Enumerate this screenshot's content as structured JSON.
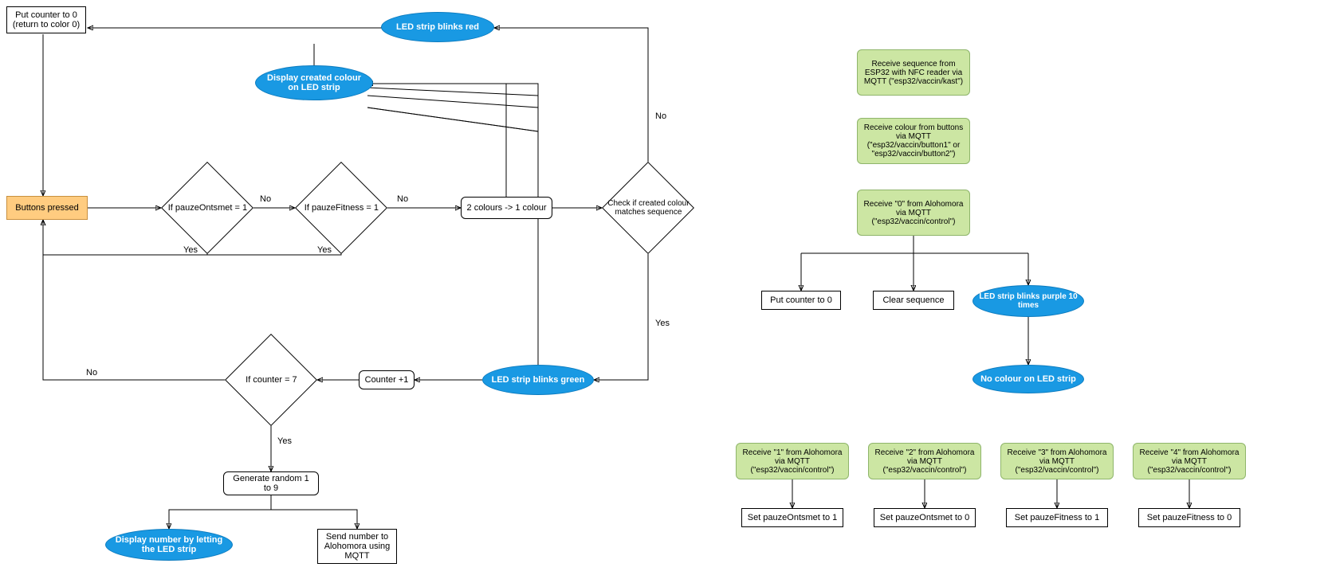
{
  "left": {
    "put_counter_0": "Put counter to 0\n(return to color 0)",
    "buttons_pressed": "Buttons pressed",
    "if_pauze_ontsmet": "If pauzeOntsmet = 1",
    "if_pauze_fitness": "If pauzeFitness = 1",
    "two_colours": "2 colours -> 1 colour",
    "check_match": "Check if created colour matches sequence",
    "led_red": "LED strip blinks red",
    "display_colour": "Display created colour on LED strip",
    "led_green": "LED strip blinks green",
    "counter_plus": "Counter +1",
    "if_counter_7": "If counter = 7",
    "gen_random": "Generate random 1 to 9",
    "display_number": "Display number by letting the LED strip",
    "send_number": "Send number to Alohomora using MQTT"
  },
  "right": {
    "recv_seq": "Receive sequence from ESP32 with NFC reader via MQTT (\"esp32/vaccin/kast\")",
    "recv_colour": "Receive colour from buttons via MQTT (\"esp32/vaccin/button1\" or \"esp32/vaccin/button2\")",
    "recv_0": "Receive \"0\" from Alohomora via MQTT (\"esp32/vaccin/control\")",
    "put_counter_0_r": "Put counter to 0",
    "clear_seq": "Clear sequence",
    "led_purple": "LED strip blinks purple 10 times",
    "no_colour": "No colour on LED strip",
    "recv_1": "Receive \"1\" from Alohomora via MQTT (\"esp32/vaccin/control\")",
    "recv_2": "Receive \"2\" from Alohomora via MQTT (\"esp32/vaccin/control\")",
    "recv_3": "Receive \"3\" from Alohomora via MQTT (\"esp32/vaccin/control\")",
    "recv_4": "Receive \"4\" from Alohomora via MQTT (\"esp32/vaccin/control\")",
    "set_ontsmet_1": "Set pauzeOntsmet to 1",
    "set_ontsmet_0": "Set pauzeOntsmet to 0",
    "set_fitness_1": "Set pauzeFitness to 1",
    "set_fitness_0": "Set pauzeFitness to 0"
  },
  "labels": {
    "yes": "Yes",
    "no": "No"
  }
}
